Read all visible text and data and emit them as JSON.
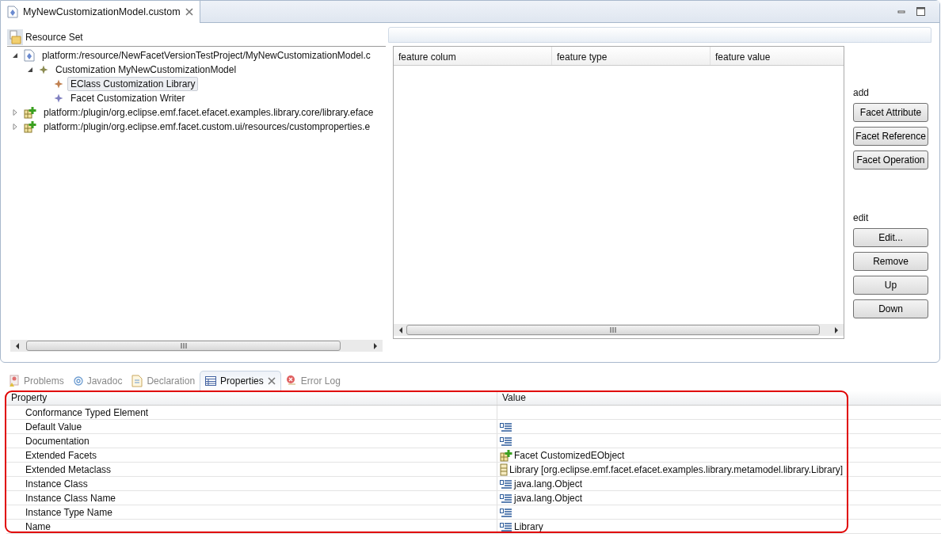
{
  "editor": {
    "tab": {
      "title": "MyNewCustomizationModel.custom",
      "selected": true
    },
    "tree": {
      "root_label": "Resource Set",
      "items": [
        {
          "label": "platform:/resource/NewFacetVersionTestProject/MyNewCustomizationModel.c",
          "kind": "resource",
          "expanded": true,
          "selected": false,
          "children": [
            {
              "label": "Customization MyNewCustomizationModel",
              "kind": "customization",
              "expanded": true,
              "selected": false,
              "children": [
                {
                  "label": "EClass Customization Library",
                  "kind": "eclass",
                  "selected": true
                },
                {
                  "label": "Facet Customization Writer",
                  "kind": "facet",
                  "selected": false
                }
              ]
            }
          ]
        },
        {
          "label": "platform:/plugin/org.eclipse.emf.facet.efacet.examples.library.core/library.eface",
          "kind": "facetset",
          "expanded": false,
          "selected": false
        },
        {
          "label": "platform:/plugin/org.eclipse.emf.facet.custom.ui/resources/customproperties.e",
          "kind": "facetset",
          "expanded": false,
          "selected": false
        }
      ]
    },
    "feature_table": {
      "columns": [
        "feature colum",
        "feature type",
        "feature value"
      ]
    },
    "add_label": "add",
    "add_buttons": [
      "Facet Attribute",
      "Facet Reference",
      "Facet Operation"
    ],
    "edit_label": "edit",
    "edit_buttons": [
      "Edit...",
      "Remove",
      "Up",
      "Down"
    ]
  },
  "views": {
    "tabs": [
      {
        "label": "Problems",
        "kind": "problems",
        "selected": false
      },
      {
        "label": "Javadoc",
        "kind": "javadoc",
        "selected": false
      },
      {
        "label": "Declaration",
        "kind": "declaration",
        "selected": false
      },
      {
        "label": "Properties",
        "kind": "properties",
        "selected": true
      },
      {
        "label": "Error Log",
        "kind": "errorlog",
        "selected": false
      }
    ]
  },
  "properties": {
    "columns": [
      "Property",
      "Value"
    ],
    "rows": [
      {
        "name": "Conformance Typed Element"
      },
      {
        "name": "Default Value",
        "kind": "text"
      },
      {
        "name": "Documentation",
        "kind": "text"
      },
      {
        "name": "Extended Facets",
        "kind": "facet",
        "value": "Facet CustomizedEObject"
      },
      {
        "name": "Extended Metaclass",
        "kind": "class",
        "value": "Library [org.eclipse.emf.facet.efacet.examples.library.metamodel.library.Library]"
      },
      {
        "name": "Instance Class",
        "kind": "text",
        "value": "java.lang.Object"
      },
      {
        "name": "Instance Class Name",
        "kind": "text",
        "value": "java.lang.Object"
      },
      {
        "name": "Instance Type Name",
        "kind": "text"
      },
      {
        "name": "Name",
        "kind": "text",
        "value": "Library"
      }
    ]
  }
}
